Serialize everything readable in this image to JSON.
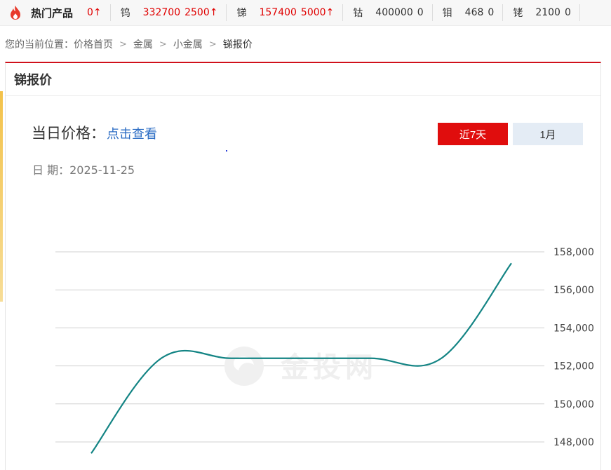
{
  "ticker": {
    "hot_title": "热门产品",
    "hot_change": "0↑",
    "items": [
      {
        "name": "钨",
        "price": "332700",
        "change": "2500↑",
        "trend": "up"
      },
      {
        "name": "锑",
        "price": "157400",
        "change": "5000↑",
        "trend": "up"
      },
      {
        "name": "钴",
        "price": "400000",
        "change": "0",
        "trend": "flat"
      },
      {
        "name": "钼",
        "price": "468",
        "change": "0",
        "trend": "flat"
      },
      {
        "name": "铑",
        "price": "2100",
        "change": "0",
        "trend": "flat"
      }
    ],
    "colors": {
      "up": "#e00000",
      "flat": "#333333"
    }
  },
  "breadcrumb": {
    "prefix": "您的当前位置：",
    "items": [
      "价格首页",
      "金属",
      "小金属"
    ],
    "current": "锑报价"
  },
  "panel": {
    "title": "锑报价",
    "day_price_label": "当日价格：",
    "day_price_link": "点击查看",
    "date_label": "日 期：",
    "date_value": "2025-11-25",
    "range_buttons": [
      "近7天",
      "1月"
    ],
    "active_range": "近7天",
    "accent_color": "#d0111b"
  },
  "watermark": {
    "text": "金投网"
  },
  "chart_data": {
    "type": "line",
    "title": "",
    "xlabel": "",
    "ylabel": "",
    "ylim": [
      147000,
      158500
    ],
    "yticks": [
      148000,
      150000,
      152000,
      154000,
      156000,
      158000
    ],
    "ytick_labels": [
      "148,000",
      "150,000",
      "152,000",
      "154,000",
      "156,000",
      "158,000"
    ],
    "grid": true,
    "line_color": "#138484",
    "series": [
      {
        "values": [
          147400,
          152400,
          152400,
          152400,
          152400,
          152400,
          157400
        ]
      }
    ]
  }
}
